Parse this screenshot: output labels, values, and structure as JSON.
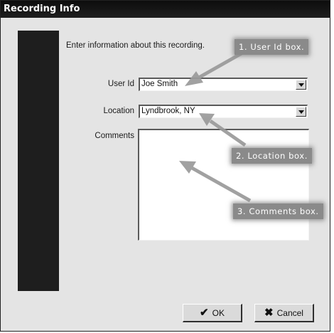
{
  "window": {
    "title": "Recording Info"
  },
  "form": {
    "instruction": "Enter information about this recording.",
    "user_id_label": "User Id",
    "user_id_value": "Joe Smith",
    "location_label": "Location",
    "location_value": "Lyndbrook, NY",
    "comments_label": "Comments",
    "comments_value": ""
  },
  "buttons": {
    "ok_label": "OK",
    "ok_icon": "checkmark-icon",
    "cancel_label": "Cancel",
    "cancel_icon": "x-icon"
  },
  "callouts": {
    "user_id": "1. User Id box.",
    "location": "2. Location box.",
    "comments": "3. Comments box."
  },
  "colors": {
    "title_bar": "#111111",
    "dialog_bg": "#e4e4e4",
    "callout_bg": "#8a8a8a",
    "arrow": "#9a9a9a"
  }
}
